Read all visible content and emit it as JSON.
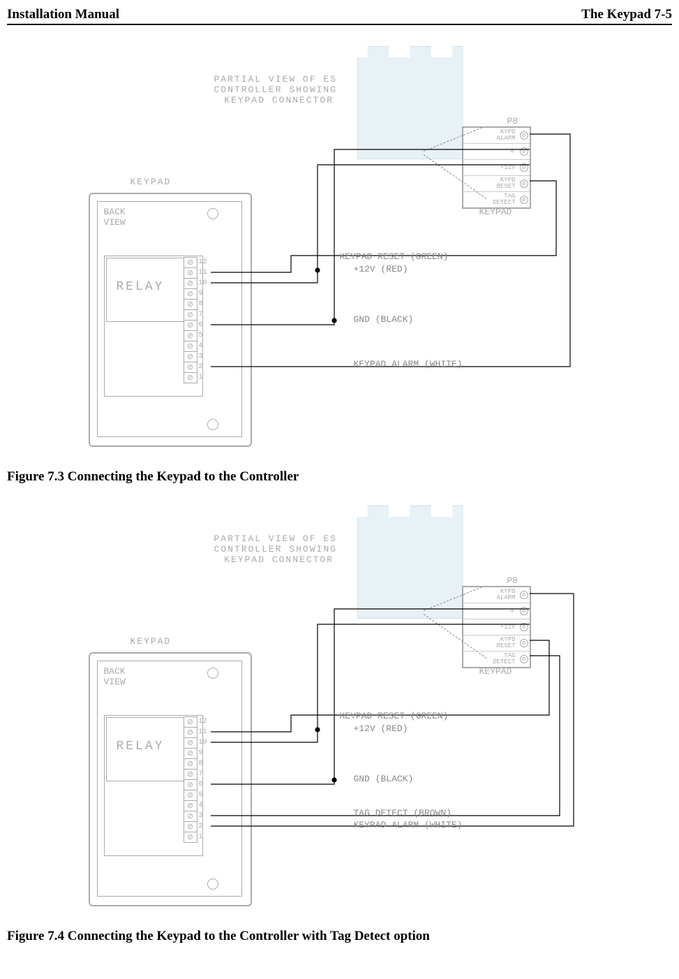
{
  "header": {
    "left": "Installation Manual",
    "right": "The Keypad 7-5"
  },
  "captions": {
    "fig73": "Figure 7.3 Connecting the Keypad to the Controller",
    "fig74": "Figure 7.4 Connecting the Keypad to the Controller with Tag Detect option"
  },
  "diagram_text": {
    "partial_view": "PARTIAL VIEW OF ES\nCONTROLLER SHOWING\n KEYPAD CONNECTOR",
    "keypad_label": "KEYPAD",
    "back_view": "BACK\nVIEW",
    "relay": "RELAY",
    "p8": "P8",
    "keypad_bottom": "KEYPAD"
  },
  "p8_terminals": [
    "KYPD\nALARM",
    "⏚",
    "+12V",
    "KYPD\nRESET",
    "TAG\nDETECT"
  ],
  "terminal_numbers": [
    "12",
    "11",
    "10",
    "9",
    "8",
    "7",
    "6",
    "5",
    "4",
    "3",
    "2",
    "1"
  ],
  "wire_labels_73": {
    "reset": "KEYPAD RESET (GREEN)",
    "v12": "+12V (RED)",
    "gnd": "GND (BLACK)",
    "alarm": "KEYPAD ALARM (WHITE)"
  },
  "wire_labels_74": {
    "reset": "KEYPAD RESET (GREEN)",
    "v12": "+12V (RED)",
    "gnd": "GND (BLACK)",
    "tag": "TAG DETECT (BROWN)",
    "alarm": "KEYPAD ALARM (WHITE)"
  },
  "chart_data": [
    {
      "type": "diagram",
      "title": "Figure 7.3 Connecting the Keypad to the Controller",
      "keypad_terminals": {
        "count": 12,
        "numbers": [
          12,
          11,
          10,
          9,
          8,
          7,
          6,
          5,
          4,
          3,
          2,
          1
        ]
      },
      "controller_connector": {
        "name": "P8",
        "pins": [
          "KYPD ALARM",
          "GND",
          "+12V",
          "KYPD RESET",
          "TAG DETECT"
        ]
      },
      "connections": [
        {
          "from_keypad_terminal": 11,
          "to_p8_pin": "KYPD RESET",
          "color": "GREEN",
          "label": "KEYPAD RESET (GREEN)"
        },
        {
          "from_keypad_terminal": 10,
          "to_p8_pin": "+12V",
          "color": "RED",
          "label": "+12V (RED)"
        },
        {
          "from_keypad_terminal": 6,
          "to_p8_pin": "GND",
          "color": "BLACK",
          "label": "GND (BLACK)"
        },
        {
          "from_keypad_terminal": 2,
          "to_p8_pin": "KYPD ALARM",
          "color": "WHITE",
          "label": "KEYPAD ALARM (WHITE)"
        }
      ]
    },
    {
      "type": "diagram",
      "title": "Figure 7.4 Connecting the Keypad to the Controller with Tag Detect option",
      "keypad_terminals": {
        "count": 12,
        "numbers": [
          12,
          11,
          10,
          9,
          8,
          7,
          6,
          5,
          4,
          3,
          2,
          1
        ]
      },
      "controller_connector": {
        "name": "P8",
        "pins": [
          "KYPD ALARM",
          "GND",
          "+12V",
          "KYPD RESET",
          "TAG DETECT"
        ]
      },
      "connections": [
        {
          "from_keypad_terminal": 11,
          "to_p8_pin": "KYPD RESET",
          "color": "GREEN",
          "label": "KEYPAD RESET (GREEN)"
        },
        {
          "from_keypad_terminal": 10,
          "to_p8_pin": "+12V",
          "color": "RED",
          "label": "+12V (RED)"
        },
        {
          "from_keypad_terminal": 6,
          "to_p8_pin": "GND",
          "color": "BLACK",
          "label": "GND (BLACK)"
        },
        {
          "from_keypad_terminal": 3,
          "to_p8_pin": "TAG DETECT",
          "color": "BROWN",
          "label": "TAG DETECT (BROWN)"
        },
        {
          "from_keypad_terminal": 2,
          "to_p8_pin": "KYPD ALARM",
          "color": "WHITE",
          "label": "KEYPAD ALARM (WHITE)"
        }
      ]
    }
  ]
}
